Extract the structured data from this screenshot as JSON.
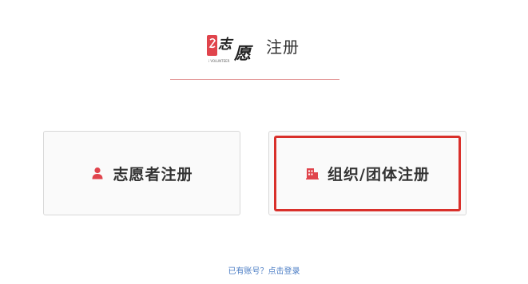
{
  "header": {
    "logo_brand_text": "志愿",
    "logo_subtext": "i VOLUNTEER",
    "title": "注册"
  },
  "options": [
    {
      "label": "志愿者注册",
      "icon": "user-icon"
    },
    {
      "label": "组织/团体注册",
      "icon": "building-icon"
    }
  ],
  "footer": {
    "login_link": "已有账号？点击登录"
  },
  "colors": {
    "accent": "#e0444c",
    "highlight": "#d9302b",
    "link": "#4a7cc4",
    "divider": "#e08c8c"
  }
}
